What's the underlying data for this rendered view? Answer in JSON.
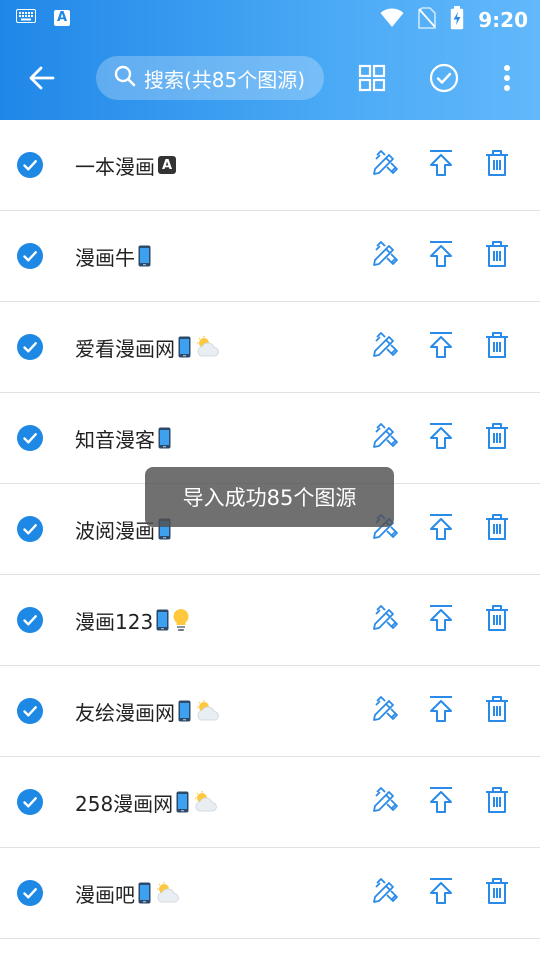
{
  "status_bar": {
    "time": "9:20",
    "left_icons": [
      "keyboard-icon",
      "a-app-icon"
    ],
    "a_letter": "A",
    "right_icons": [
      "wifi-icon",
      "no-sim-icon",
      "battery-charging-icon"
    ]
  },
  "toolbar": {
    "back_icon": "arrow-left-icon",
    "search_placeholder": "搜索(共85个图源)",
    "actions": [
      "grid-view-icon",
      "select-all-icon",
      "more-vert-icon"
    ]
  },
  "colors": {
    "accent": "#2a8ae8",
    "appbar_start": "#1f87e8",
    "appbar_end": "#62b8fb",
    "check": "#1e88e5",
    "icon": "#2a8ae8"
  },
  "sources": [
    {
      "name": "一本漫画",
      "checked": true,
      "badges": [
        "A"
      ]
    },
    {
      "name": "漫画牛",
      "checked": true,
      "badges": [
        "phone"
      ]
    },
    {
      "name": "爱看漫画网",
      "checked": true,
      "badges": [
        "phone",
        "cloud"
      ]
    },
    {
      "name": "知音漫客",
      "checked": true,
      "badges": [
        "phone"
      ]
    },
    {
      "name": "波阅漫画",
      "checked": true,
      "badges": [
        "phone"
      ]
    },
    {
      "name": "漫画123",
      "checked": true,
      "badges": [
        "phone",
        "bulb"
      ]
    },
    {
      "name": "友绘漫画网",
      "checked": true,
      "badges": [
        "phone",
        "cloud"
      ]
    },
    {
      "name": "258漫画网",
      "checked": true,
      "badges": [
        "phone",
        "cloud"
      ]
    },
    {
      "name": "漫画吧",
      "checked": true,
      "badges": [
        "phone",
        "cloud"
      ]
    }
  ],
  "row_actions": [
    "edit-icon",
    "move-to-top-icon",
    "delete-icon"
  ],
  "toast": {
    "text": "导入成功85个图源"
  }
}
